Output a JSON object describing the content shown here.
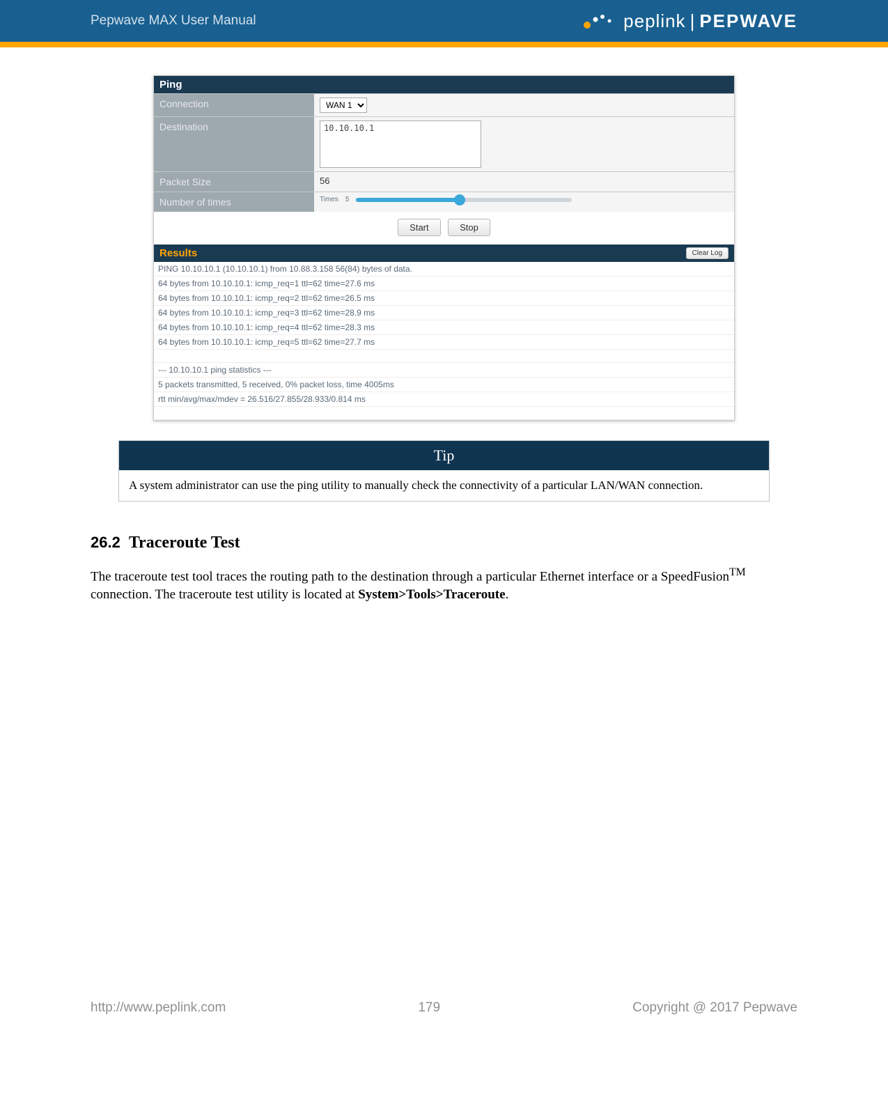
{
  "header": {
    "manual_title": "Pepwave MAX User Manual",
    "brand_left": "peplink",
    "brand_sep": "|",
    "brand_right": "PEPWAVE"
  },
  "ping": {
    "title": "Ping",
    "connection_label": "Connection",
    "connection_value": "WAN 1",
    "destination_label": "Destination",
    "destination_value": "10.10.10.1",
    "packet_size_label": "Packet Size",
    "packet_size_value": "56",
    "times_label": "Number of times",
    "times_caption": "Times",
    "times_value": "5",
    "start_label": "Start",
    "stop_label": "Stop"
  },
  "results": {
    "title": "Results",
    "clear_label": "Clear Log",
    "lines": [
      "PING 10.10.10.1 (10.10.10.1) from 10.88.3.158 56(84) bytes of data.",
      "64 bytes from 10.10.10.1: icmp_req=1 ttl=62 time=27.6 ms",
      "64 bytes from 10.10.10.1: icmp_req=2 ttl=62 time=26.5 ms",
      "64 bytes from 10.10.10.1: icmp_req=3 ttl=62 time=28.9 ms",
      "64 bytes from 10.10.10.1: icmp_req=4 ttl=62 time=28.3 ms",
      "64 bytes from 10.10.10.1: icmp_req=5 ttl=62 time=27.7 ms",
      "",
      "--- 10.10.10.1 ping statistics ---",
      "5 packets transmitted, 5 received, 0% packet loss, time 4005ms",
      "rtt min/avg/max/mdev = 26.516/27.855/28.933/0.814 ms",
      ""
    ]
  },
  "tip": {
    "head": "Tip",
    "body": "A system administrator can use the ping utility to manually check the connectivity of a particular LAN/WAN connection."
  },
  "section": {
    "num": "26.2",
    "title": "Traceroute Test",
    "p_pre": "The traceroute test tool traces the routing path to the destination through a particular Ethernet interface or a SpeedFusion",
    "tm": "TM",
    "p_mid": " connection. The traceroute test utility is located at ",
    "path": "System>Tools>Traceroute",
    "p_end": "."
  },
  "footer": {
    "url": "http://www.peplink.com",
    "page": "179",
    "copyright": "Copyright @ 2017 Pepwave"
  }
}
